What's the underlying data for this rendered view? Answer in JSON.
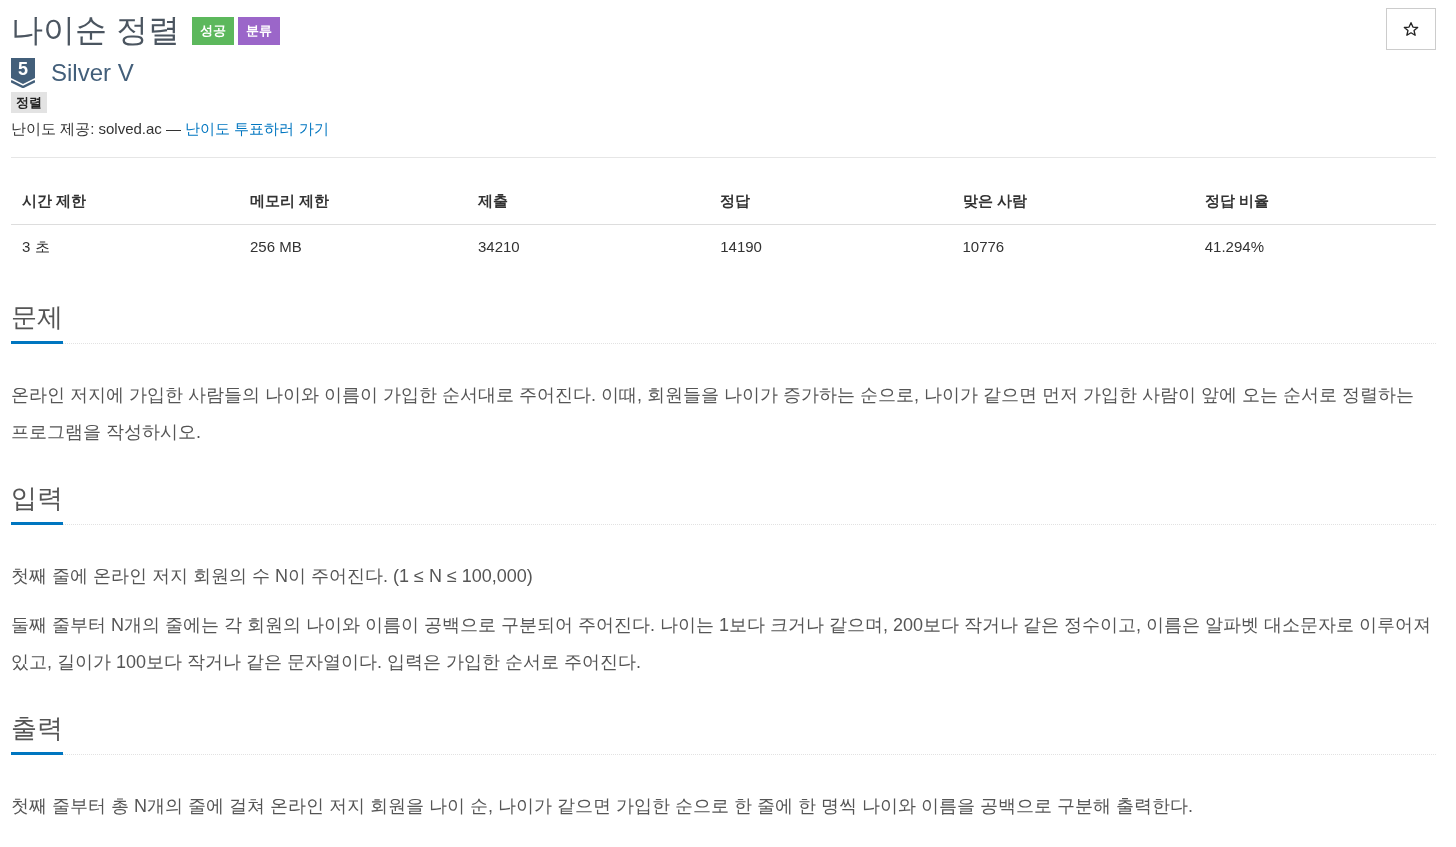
{
  "title": "나이순 정렬",
  "badges": [
    {
      "text": "성공",
      "color": "#5cb85c"
    },
    {
      "text": "분류",
      "color": "#9b66c9"
    }
  ],
  "tier": {
    "level": "5",
    "name": "Silver V"
  },
  "tags": [
    "정렬"
  ],
  "difficulty_note": {
    "text": "난이도 제공: solved.ac —",
    "link": "난이도 투표하러 가기"
  },
  "stats": {
    "columns": [
      "시간 제한",
      "메모리 제한",
      "제출",
      "정답",
      "맞은 사람",
      "정답 비율"
    ],
    "rows": [
      [
        "3 초",
        "256 MB",
        "34210",
        "14190",
        "10776",
        "41.294%"
      ]
    ]
  },
  "sections": [
    {
      "heading": "문제",
      "paragraphs": [
        "온라인 저지에 가입한 사람들의 나이와 이름이 가입한 순서대로 주어진다. 이때, 회원들을 나이가 증가하는 순으로, 나이가 같으면 먼저 가입한 사람이 앞에 오는 순서로 정렬하는 프로그램을 작성하시오."
      ]
    },
    {
      "heading": "입력",
      "paragraphs": [
        "첫째 줄에 온라인 저지 회원의 수 N이 주어진다. (1 ≤ N ≤ 100,000)",
        "둘째 줄부터 N개의 줄에는 각 회원의 나이와 이름이 공백으로 구분되어 주어진다. 나이는 1보다 크거나 같으며, 200보다 작거나 같은 정수이고, 이름은 알파벳 대소문자로 이루어져 있고, 길이가 100보다 작거나 같은 문자열이다. 입력은 가입한 순서로 주어진다."
      ]
    },
    {
      "heading": "출력",
      "paragraphs": [
        "첫째 줄부터 총 N개의 줄에 걸쳐 온라인 저지 회원을 나이 순, 나이가 같으면 가입한 순으로 한 줄에 한 명씩 나이와 이름을 공백으로 구분해 출력한다."
      ]
    }
  ]
}
